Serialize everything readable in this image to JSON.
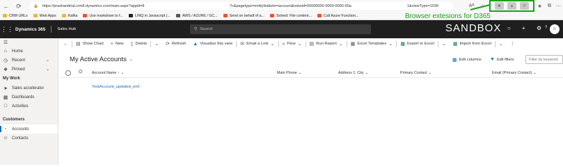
{
  "browser": {
    "url_part1": "https://prashanttrial.crm8.dynamics.com/main.aspx?appid=8",
    "url_part2": "7c&pagetype=entitylist&etn=account&viewid=00000000-0000-0000-00a",
    "url_part3": "1&viewType=1039",
    "reader_label": "Aᴬ",
    "bookmarks": [
      {
        "label": "CRM URLs",
        "color": "#e8b73a"
      },
      {
        "label": "Web Apps",
        "color": "#e8b73a"
      },
      {
        "label": "Kafka",
        "color": "#e8b73a"
      },
      {
        "label": "Use markdown to f...",
        "color": "#f25022"
      },
      {
        "label": "LINQ in Javascript (...",
        "color": "#222222"
      },
      {
        "label": "AWS / AZURE / GC...",
        "color": "#555555"
      },
      {
        "label": "Send on behalf of a...",
        "color": "#f25022"
      },
      {
        "label": "Solved: File content...",
        "color": "#f25022"
      },
      {
        "label": "Call Azure Function...",
        "color": "#f25022"
      }
    ]
  },
  "annotation": {
    "text": "Browser extesions for D365",
    "color": "#1aa11a"
  },
  "appbar": {
    "app_name": "Dynamics 365",
    "hub_name": "Sales Hub",
    "search_placeholder": "Search",
    "environment": "SANDBOX"
  },
  "sidebar": {
    "items_top": [
      {
        "label": "Home",
        "icon": "home-icon"
      },
      {
        "label": "Recent",
        "icon": "clock-icon"
      },
      {
        "label": "Pinned",
        "icon": "pin-icon"
      }
    ],
    "section_mywork": "My Work",
    "items_mywork": [
      {
        "label": "Sales accelerator",
        "icon": "rocket-icon"
      },
      {
        "label": "Dashboards",
        "icon": "dashboard-icon"
      },
      {
        "label": "Activities",
        "icon": "clipboard-icon"
      }
    ],
    "section_customers": "Customers",
    "items_customers": [
      {
        "label": "Accounts",
        "icon": "building-icon"
      },
      {
        "label": "Contacts",
        "icon": "person-icon"
      }
    ]
  },
  "commands": {
    "show_chart": "Show Chart",
    "new": "New",
    "delete": "Delete",
    "refresh": "Refresh",
    "visualize": "Visualize this view",
    "email_link": "Email a Link",
    "flow": "Flow",
    "run_report": "Run Report",
    "excel_templates": "Excel Templates",
    "export_excel": "Export to Excel",
    "import_excel": "Import from Excel"
  },
  "view": {
    "title": "My Active Accounts",
    "edit_columns": "Edit columns",
    "edit_filters": "Edit filters",
    "filter_placeholder": "Filter by keyword"
  },
  "grid": {
    "columns": [
      "Account Name ↑",
      "Main Phone",
      "Address 1: City",
      "Primary Contact",
      "Email (Primary Contact)"
    ],
    "rows": [
      {
        "account_name": "TestAccount_updated_en0"
      }
    ]
  }
}
